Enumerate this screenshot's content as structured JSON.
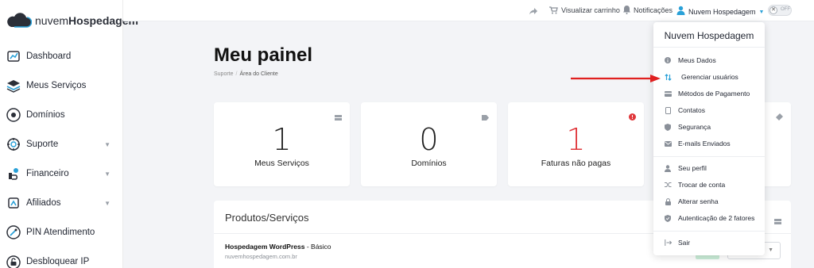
{
  "brand": {
    "prefix": "nuvem",
    "bold": "Hospedagem"
  },
  "sidebar": {
    "items": [
      {
        "label": "Dashboard",
        "icon": "dashboard-icon",
        "chevron": false
      },
      {
        "label": "Meus Serviços",
        "icon": "layers-icon",
        "chevron": false
      },
      {
        "label": "Domínios",
        "icon": "domain-icon",
        "chevron": false
      },
      {
        "label": "Suporte",
        "icon": "support-icon",
        "chevron": true
      },
      {
        "label": "Financeiro",
        "icon": "finance-icon",
        "chevron": true
      },
      {
        "label": "Afiliados",
        "icon": "affiliates-icon",
        "chevron": true
      },
      {
        "label": "PIN Atendimento",
        "icon": "pin-icon",
        "chevron": false
      },
      {
        "label": "Desbloquear IP",
        "icon": "unlock-icon",
        "chevron": false
      }
    ]
  },
  "topbar": {
    "cart_label": "Visualizar carrinho",
    "notifications_label": "Notificações",
    "user_name": "Nuvem Hospedagem",
    "toggle_label": "OFF",
    "toggle_mark": "✕"
  },
  "main": {
    "title": "Meu painel",
    "breadcrumb": [
      "Suporte",
      "Área do Cliente"
    ],
    "cards": [
      {
        "value": "1",
        "label": "Meus Serviços",
        "alert": false
      },
      {
        "value": "0",
        "label": "Domínios",
        "alert": false
      },
      {
        "value": "1",
        "label": "Faturas não pagas",
        "alert": true
      }
    ],
    "products_panel": {
      "title": "Produtos/Serviços",
      "product_name": "Hospedagem WordPress",
      "product_plan": " - Básico",
      "product_domain": "nuvemhospedagem.com.br"
    }
  },
  "dropdown": {
    "header": "Nuvem Hospedagem",
    "group1": [
      {
        "label": "Meus Dados",
        "icon": "info-icon"
      },
      {
        "label": "Gerenciar usuários",
        "icon": "sort-arrows-icon"
      },
      {
        "label": "Métodos de Pagamento",
        "icon": "credit-card-icon"
      },
      {
        "label": "Contatos",
        "icon": "contacts-icon"
      },
      {
        "label": "Segurança",
        "icon": "shield-icon"
      },
      {
        "label": "E-mails Enviados",
        "icon": "mail-icon"
      }
    ],
    "group2": [
      {
        "label": "Seu perfil",
        "icon": "user-icon"
      },
      {
        "label": "Trocar de conta",
        "icon": "shuffle-icon"
      },
      {
        "label": "Alterar senha",
        "icon": "lock-icon"
      },
      {
        "label": "Autenticação de 2 fatores",
        "icon": "shield-check-icon"
      }
    ],
    "group3": [
      {
        "label": "Sair",
        "icon": "logout-icon"
      }
    ]
  },
  "colors": {
    "accent": "#2aa1d8",
    "alert": "#e0383c",
    "annotation_arrow": "#e02020"
  }
}
